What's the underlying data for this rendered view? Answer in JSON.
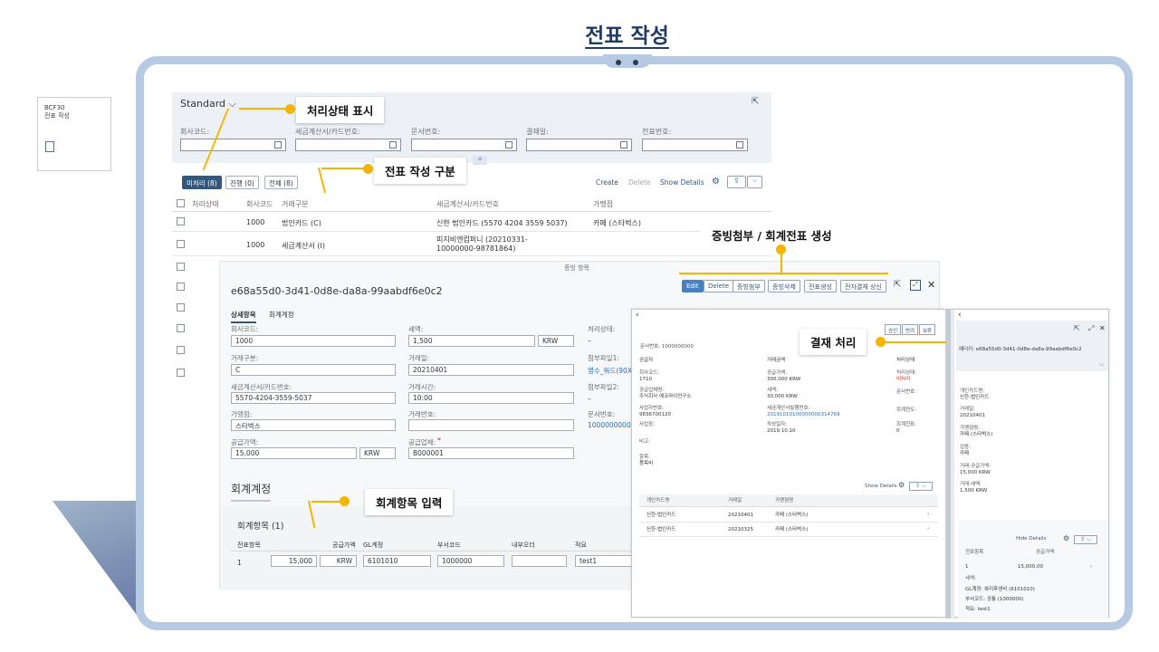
{
  "page_title": "전표 작성",
  "tile": {
    "line1": "BCF30",
    "line2": "전표 작성"
  },
  "list_report": {
    "variant": "Standard ⌵",
    "filters": [
      "회사코드:",
      "세금계산서/카드번호:",
      "문서번호:",
      "결재일:",
      "전표번호:"
    ],
    "tabs": [
      "미처리 (8)",
      "진행 (0)",
      "전체 (8)"
    ],
    "toolbar": {
      "create": "Create",
      "delete": "Delete",
      "show_details": "Show Details"
    },
    "columns": [
      "처리상태",
      "회사코드",
      "거래구분",
      "세금계산서/카드번호",
      "가맹점"
    ],
    "rows": [
      {
        "company": "1000",
        "type": "법인카드 (C)",
        "number": "신한 법인카드 (5570 4204 3559 5037)",
        "merchant": "카페 (스타벅스)"
      },
      {
        "company": "1000",
        "type": "세금계산서 (I)",
        "number": "피지비엔컴퍼니 (20210331-10000000-98781864)",
        "merchant": ""
      }
    ]
  },
  "object_page": {
    "header_label": "증빙 항목",
    "id": "e68a55d0-3d41-0d8e-da8a-99aabdf6e0c2",
    "buttons": [
      "Edit",
      "Delete",
      "증빙첨부",
      "증빙삭제",
      "전표생성",
      "전자결재 상신"
    ],
    "tabs": [
      "상세항목",
      "회계계정"
    ],
    "fields": {
      "company_label": "회사코드:",
      "company": "1000",
      "tax_label": "세액:",
      "tax": "1,500",
      "tax_cur": "KRW",
      "status_label": "처리상태:",
      "status": "–",
      "type_label": "거래구분:",
      "type": "C",
      "date_label": "거래일:",
      "date": "20210401",
      "attach1_label": "첨부파일1:",
      "attach1": "영수_워드(90X)",
      "card_label": "세금계산서/카드번호:",
      "card": "5570-4204-3559-5037",
      "time_label": "거래시간:",
      "time": "10:00",
      "attach2_label": "첨부파일2:",
      "attach2": "–",
      "merchant_label": "가맹점:",
      "merchant": "스타벅스",
      "trxno_label": "거래번호:",
      "trxno": "",
      "docno_label": "문서번호:",
      "docno": "1000000000",
      "supply_label": "공급가액:",
      "supply": "15,000",
      "supply_cur": "KRW",
      "vendor_label": "공급업체:",
      "vendor": "B000001"
    },
    "section_title": "회계계정",
    "subsection_title": "회계항목 (1)",
    "item_columns": [
      "전표항목",
      "공급가액",
      "GL계정",
      "부서코드",
      "내부오더",
      "적요"
    ],
    "item_row": {
      "no": "1",
      "amount": "15,000",
      "cur": "KRW",
      "gl": "6101010",
      "dept": "1000000",
      "order": "",
      "note": "test1"
    }
  },
  "panel2": {
    "docno": "문서번호: 1000000000",
    "buttons": [
      "승인",
      "반려",
      "보류"
    ],
    "sections": [
      "공급자",
      "거래금액",
      "처리상태"
    ],
    "fields": [
      [
        "회사코드:",
        "1710"
      ],
      [
        "공급가액:",
        "300,000 KRW"
      ],
      [
        "처리상태:",
        "미처리"
      ],
      [
        "공급업체명:",
        "주식회사 에코라이언구소"
      ],
      [
        "세액:",
        "30,000 KRW"
      ],
      [
        "문서번호:",
        ""
      ],
      [
        "사업자번호:",
        "9836700120"
      ],
      [
        "세금계산서발행번호:",
        "20191010100000000314769"
      ],
      [
        "회계연도:",
        ""
      ],
      [
        "사업장:",
        ""
      ],
      [
        "작성일자:",
        "2019.10.10"
      ],
      [
        "회계전표:",
        "0"
      ]
    ],
    "notes": [
      "비고:",
      "항목:",
      "품목비"
    ],
    "show_details": "Show Details",
    "cols": [
      "개인카드명",
      "거래일",
      "가맹점명"
    ],
    "rows": [
      [
        "신한-법인카드",
        "20210401",
        "카페 (스타벅스)"
      ],
      [
        "신한-법인카드",
        "20210325",
        "카페 (스타벅스)"
      ]
    ],
    "right": {
      "title": "헤더키: e68a55d0-3d41-0d8e-da8a-99aabdf6e0c2",
      "fields": [
        [
          "개인카드명:",
          "신한-법인카드"
        ],
        [
          "거래일:",
          "20210401"
        ],
        [
          "가맹점명:",
          "카페 (스타벅스)"
        ],
        [
          "업종:",
          "카페"
        ],
        [
          "거래-공급가액:",
          "15,000 KRW"
        ],
        [
          "거래-세액:",
          "1,500 KRW"
        ]
      ],
      "hide_details": "Hide Details",
      "cols": [
        "전표항목",
        "공급가액"
      ],
      "row": [
        "1",
        "15,000.00"
      ],
      "detail": [
        "세액:",
        "GL계정: 복리후생비 (6101010)",
        "부서코드: 공통 (1000000)",
        "적요: test1"
      ]
    }
  },
  "callouts": {
    "status": "처리상태 표시",
    "category": "전표 작성 구분",
    "attach": "증빙첨부 / 회계전표 생성",
    "approval": "결재 처리",
    "accounting": "회계항목 입력"
  },
  "colors": {
    "accent": "#f4b400",
    "frame": "#b7cae3",
    "primary": "#34577c"
  }
}
